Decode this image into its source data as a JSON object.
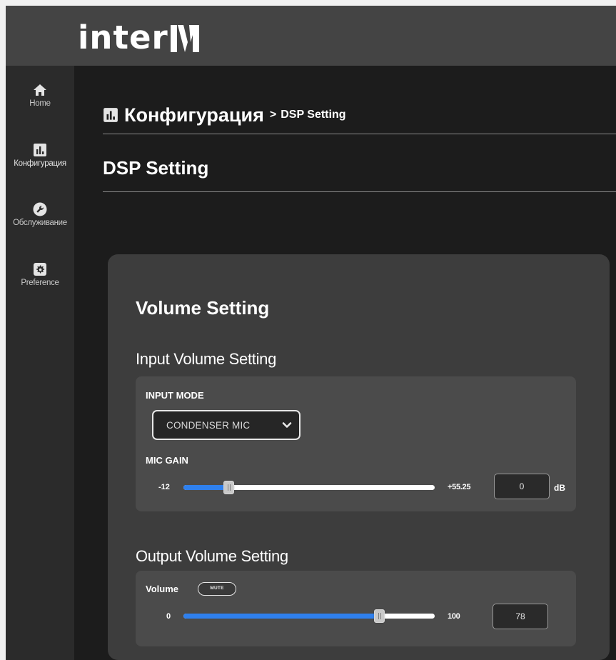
{
  "brand": {
    "logo_text": "inter",
    "logo_mark": "M"
  },
  "sidebar": {
    "items": [
      {
        "label": "Home",
        "icon": "home-icon"
      },
      {
        "label": "Конфигурация",
        "icon": "chart-icon"
      },
      {
        "label": "Обслуживание",
        "icon": "wrench-icon"
      },
      {
        "label": "Preference",
        "icon": "gear-icon"
      }
    ]
  },
  "breadcrumb": {
    "section": "Конфигурация",
    "separator": ">",
    "page": "DSP Setting"
  },
  "page": {
    "title": "DSP Setting"
  },
  "volume_setting": {
    "title": "Volume Setting",
    "input": {
      "title": "Input Volume Setting",
      "mode_label": "INPUT MODE",
      "mode_value": "CONDENSER MIC",
      "gain_label": "MIC GAIN",
      "gain_min": "-12",
      "gain_max": "+55.25",
      "gain_value": "0",
      "gain_unit": "dB",
      "gain_fraction": 0.18
    },
    "output": {
      "title": "Output Volume Setting",
      "volume_label": "Volume",
      "mute_label": "MUTE",
      "volume_min": "0",
      "volume_max": "100",
      "volume_value": "78",
      "volume_fraction": 0.78
    }
  },
  "colors": {
    "slider_fill": "#2f80ed",
    "sidebar_bg": "#2b2b2b",
    "topbar_bg": "#444444",
    "card_bg": "#3d3d3d",
    "panel_bg": "#4b4b4b"
  }
}
